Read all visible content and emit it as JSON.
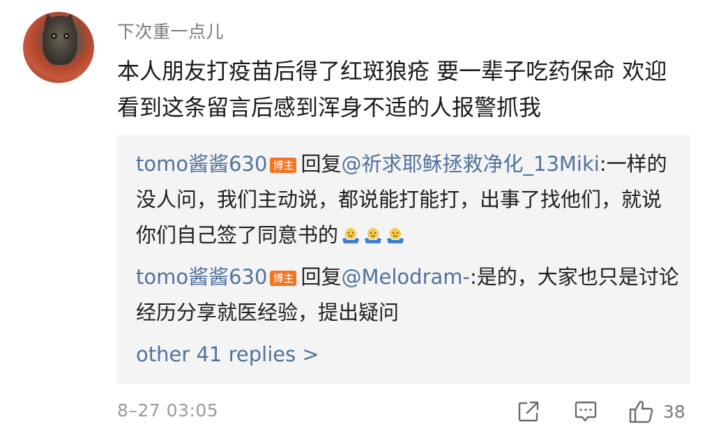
{
  "comment": {
    "author": "下次重一点儿",
    "text": "本人朋友打疫苗后得了红斑狼疮 要一辈子吃药保命 欢迎看到这条留言后感到浑身不适的人报警抓我",
    "timestamp": "8–27 03:05",
    "like_count": "38"
  },
  "replies": {
    "items": [
      {
        "author": "tomo酱酱630",
        "badge": "博主",
        "reply_word": "回复",
        "mention": "@祈求耶稣拯救净化_13Miki",
        "text": ":一样的没人问，我们主动说，都说能打能打，出事了找他们，就说你们自己签了同意书的",
        "emoji": "shrug-emoji"
      },
      {
        "author": "tomo酱酱630",
        "badge": "博主",
        "reply_word": "回复",
        "mention": "@Melodram-",
        "text": ":是的，大家也只是讨论经历分享就医经验，提出疑问"
      }
    ],
    "more_label": "other 41 replies >"
  },
  "actions": {
    "share_icon": "share-icon",
    "comment_icon": "comment-icon",
    "like_icon": "thumbs-up-icon"
  },
  "colors": {
    "link": "#50739c",
    "badge": "#f07524",
    "reply_bg": "#f4f4f4"
  }
}
